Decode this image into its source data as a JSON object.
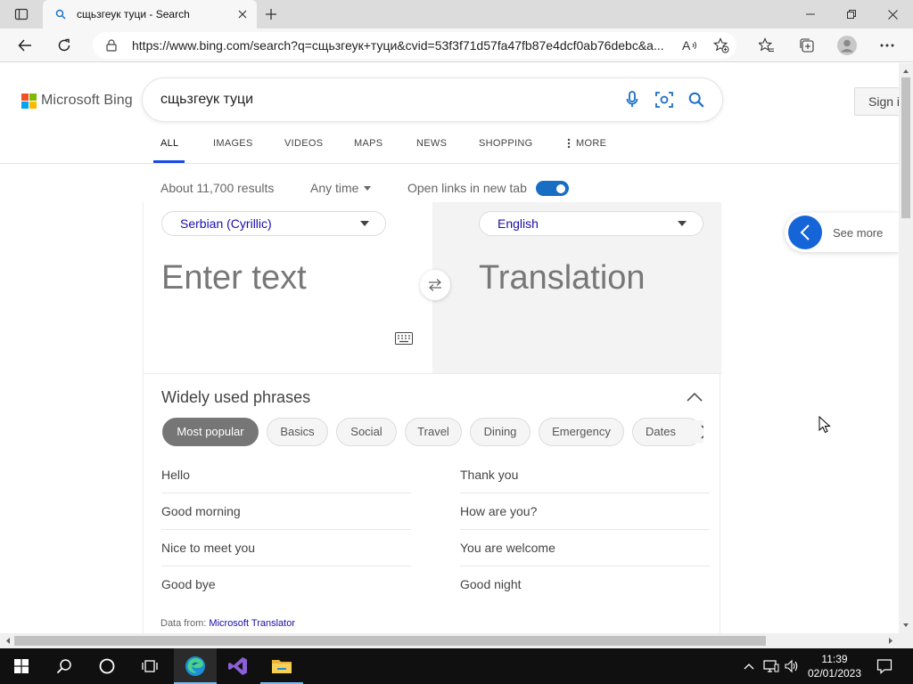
{
  "browser": {
    "tab_title": "сщьзгеук туци - Search",
    "url": "https://www.bing.com/search?q=сщьзгеук+туци&cvid=53f3f71d57fa47fb87e4dcf0ab76debc&a..."
  },
  "header": {
    "logo_text": "Microsoft Bing",
    "query": "сщьзгеук туци",
    "sign_in": "Sign in"
  },
  "nav": {
    "tabs": [
      "ALL",
      "IMAGES",
      "VIDEOS",
      "MAPS",
      "NEWS",
      "SHOPPING",
      "MORE"
    ]
  },
  "results_meta": {
    "count": "About 11,700 results",
    "time_filter": "Any time",
    "open_links_label": "Open links in new tab",
    "open_links_on": true
  },
  "translator": {
    "source_lang": "Serbian (Cyrillic)",
    "target_lang": "English",
    "input_placeholder": "Enter text",
    "output_placeholder": "Translation",
    "phrases_title": "Widely used phrases",
    "categories": [
      "Most popular",
      "Basics",
      "Social",
      "Travel",
      "Dining",
      "Emergency",
      "Dates"
    ],
    "active_category": "Most popular",
    "phrases_left": [
      "Hello",
      "Good morning",
      "Nice to meet you",
      "Good bye"
    ],
    "phrases_right": [
      "Thank you",
      "How are you?",
      "You are welcome",
      "Good night"
    ],
    "data_from_label": "Data from:",
    "data_from_link": "Microsoft Translator"
  },
  "side": {
    "see_more": "See more"
  },
  "taskbar": {
    "time": "11:39",
    "date": "02/01/2023"
  },
  "colors": {
    "accent": "#174ae4",
    "toggle": "#176ec2",
    "link": "#1a0dab",
    "chip_active": "#767676"
  }
}
